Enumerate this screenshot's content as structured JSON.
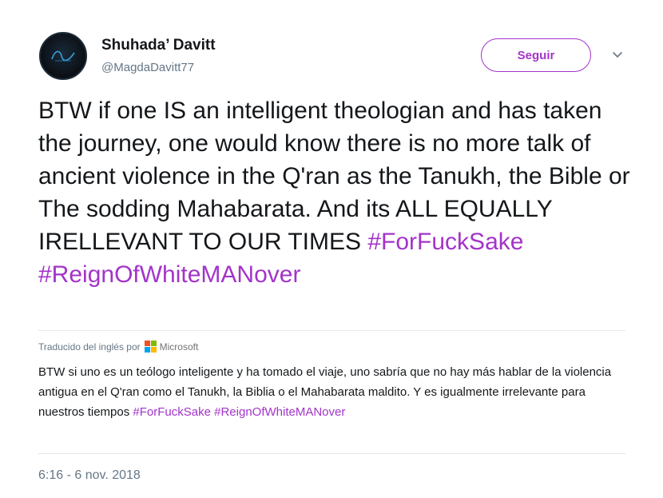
{
  "user": {
    "name": "Shuhada’ Davitt",
    "handle": "@MagdaDavitt77"
  },
  "follow_button": {
    "label": "Seguir",
    "color": "#a334c9"
  },
  "tweet": {
    "text": "BTW if one IS an intelligent theologian and has taken the journey, one would know there is no more talk of ancient violence in the Q'ran as the Tanukh, the Bible or The sodding Mahabarata. And its ALL EQUALLY IRELLEVANT TO OUR TIMES",
    "hashtags": [
      "#ForFuckSake",
      "#ReignOfWhiteMANover"
    ]
  },
  "translation": {
    "label": "Traducido del inglés por",
    "provider": "Microsoft",
    "text": "BTW si uno es un teólogo inteligente y ha tomado el viaje, uno sabría que no hay más hablar de la violencia antigua en el Q'ran como el Tanukh, la Biblia o el Mahabarata maldito. Y es igualmente irrelevante para nuestros tiempos",
    "hashtags": [
      "#ForFuckSake",
      "#ReignOfWhiteMANover"
    ]
  },
  "timestamp": "6:16 - 6 nov. 2018",
  "icons": {
    "avatar": "avatar-logo",
    "menu": "chevron-down-icon",
    "provider_logo": "microsoft-logo-icon"
  }
}
